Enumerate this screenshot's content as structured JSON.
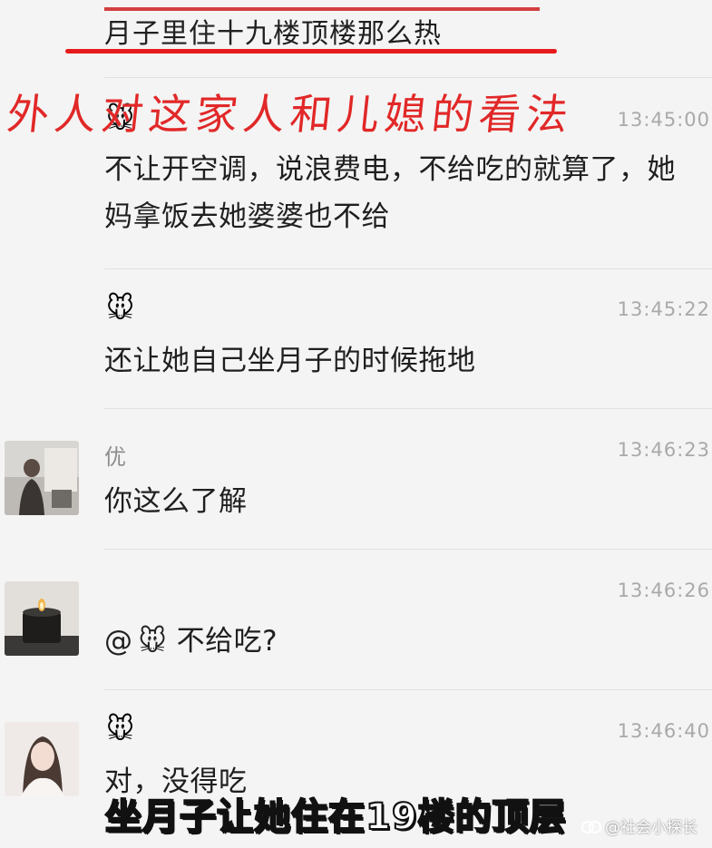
{
  "top_text": "月子里住十九楼顶楼那么热",
  "overlay_title": "外人对这家人和儿媳的看法",
  "subtitle": "坐月子让她住在19楼的顶层",
  "watermark": "@社会小探长",
  "mouse_emoji": "🐭",
  "colors": {
    "annotation_red": "#e12828",
    "timestamp": "#a9a9a9",
    "name": "#8c8c8c"
  },
  "messages": [
    {
      "name": "",
      "time": "13:45:00",
      "text": "不让开空调，说浪费电，不给吃的就算了，她妈拿饭去她婆婆也不给"
    },
    {
      "name": "",
      "time": "13:45:22",
      "text": "还让她自己坐月子的时候拖地"
    },
    {
      "name": "优",
      "time": "13:46:23",
      "text": "你这么了解"
    },
    {
      "name": "",
      "time": "13:46:26",
      "mention": "@",
      "text": "不给吃?"
    },
    {
      "name": "",
      "time": "13:46:40",
      "text": "对，没得吃"
    }
  ]
}
